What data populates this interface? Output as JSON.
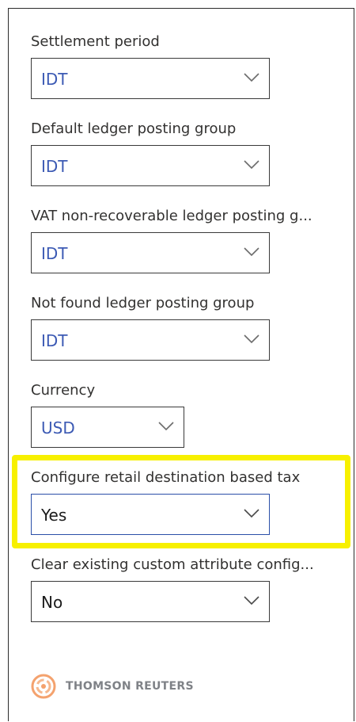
{
  "fields": [
    {
      "label": "Settlement period",
      "value": "IDT"
    },
    {
      "label": "Default ledger posting group",
      "value": "IDT"
    },
    {
      "label": "VAT non-recoverable ledger posting g...",
      "value": "IDT"
    },
    {
      "label": "Not found ledger posting group",
      "value": "IDT"
    },
    {
      "label": "Currency",
      "value": "USD"
    },
    {
      "label": "Configure retail destination based tax",
      "value": "Yes"
    },
    {
      "label": "Clear existing custom attribute config...",
      "value": "No"
    }
  ],
  "footer": {
    "brand": "THOMSON REUTERS"
  },
  "colors": {
    "highlight": "#f7f000",
    "value_text": "#3c5ab4",
    "brand_text": "#7f8287",
    "logo": "#f4a26e"
  },
  "icons": {
    "dropdown": "chevron-down-icon",
    "brand": "thomson-reuters-logo-icon"
  }
}
